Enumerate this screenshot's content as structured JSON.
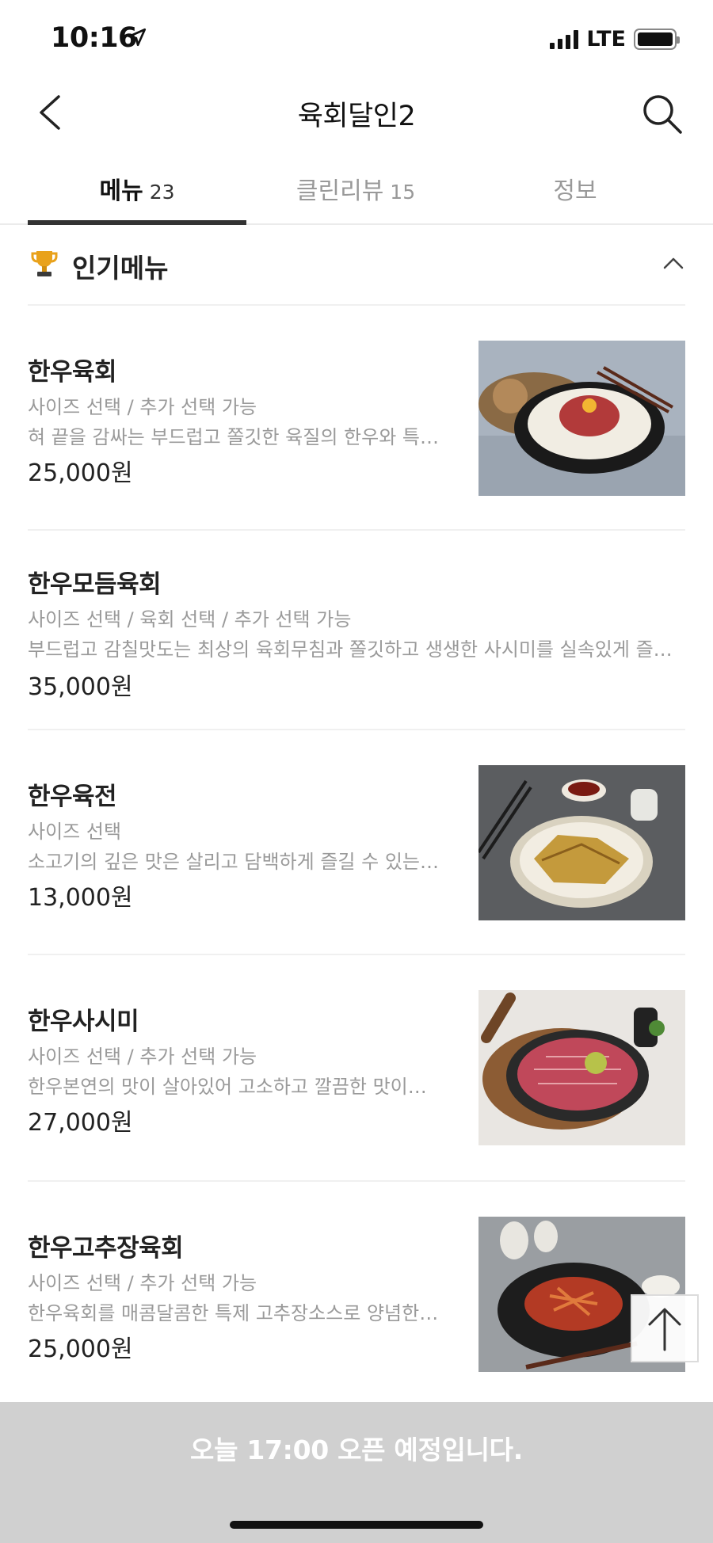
{
  "status": {
    "time": "10:16",
    "network": "LTE"
  },
  "header": {
    "title": "육회달인2"
  },
  "tabs": [
    {
      "label": "메뉴",
      "count": "23",
      "active": true
    },
    {
      "label": "클린리뷰",
      "count": "15",
      "active": false
    },
    {
      "label": "정보",
      "count": "",
      "active": false
    }
  ],
  "section": {
    "title": "인기메뉴"
  },
  "menu": [
    {
      "name": "한우육회",
      "options": "사이즈 선택 / 추가 선택 가능",
      "desc": "혀 끝을 감싸는 부드럽고 쫄깃한 육질의 한우와 특…",
      "price": "25,000원",
      "has_image": true
    },
    {
      "name": "한우모듬육회",
      "options": "사이즈 선택 / 육회 선택 / 추가 선택 가능",
      "desc": "부드럽고 감칠맛도는 최상의 육회무침과 쫄깃하고 생생한 사시미를 실속있게 즐…",
      "price": "35,000원",
      "has_image": false
    },
    {
      "name": "한우육전",
      "options": "사이즈 선택",
      "desc": "소고기의 깊은 맛은 살리고 담백하게 즐길 수 있는…",
      "price": "13,000원",
      "has_image": true
    },
    {
      "name": "한우사시미",
      "options": "사이즈 선택 / 추가 선택 가능",
      "desc": "한우본연의 맛이 살아있어 고소하고 깔끔한 맛이…",
      "price": "27,000원",
      "has_image": true
    },
    {
      "name": "한우고추장육회",
      "options": "사이즈 선택 / 추가 선택 가능",
      "desc": "한우육회를 매콤달콤한 특제 고추장소스로 양념한…",
      "price": "25,000원",
      "has_image": true
    }
  ],
  "bottom": {
    "message": "오늘 17:00 오픈 예정입니다."
  },
  "icons": {
    "back": "chevron-left-icon",
    "search": "search-icon",
    "trophy": "trophy-icon",
    "collapse": "chevron-up-icon",
    "scroll_top": "arrow-up-icon"
  },
  "colors": {
    "accent_trophy": "#e9a21b",
    "tab_indicator": "#333333",
    "bottom_bar": "#d0d0d0"
  }
}
